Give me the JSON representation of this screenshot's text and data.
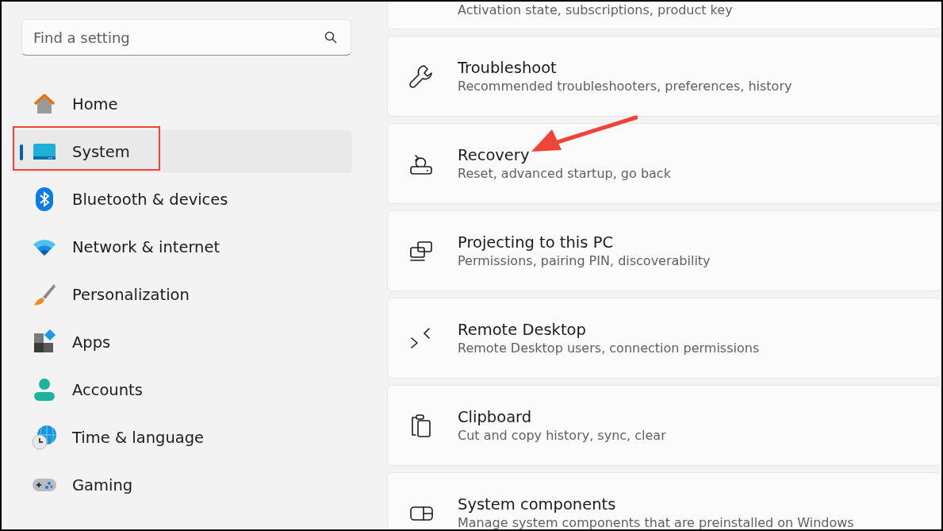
{
  "search": {
    "placeholder": "Find a setting"
  },
  "sidebar": {
    "items": [
      {
        "label": "Home",
        "kind": "home",
        "selected": false,
        "highlighted": false
      },
      {
        "label": "System",
        "kind": "system",
        "selected": true,
        "highlighted": true
      },
      {
        "label": "Bluetooth & devices",
        "kind": "bluetooth",
        "selected": false,
        "highlighted": false
      },
      {
        "label": "Network & internet",
        "kind": "wifi",
        "selected": false,
        "highlighted": false
      },
      {
        "label": "Personalization",
        "kind": "brush",
        "selected": false,
        "highlighted": false
      },
      {
        "label": "Apps",
        "kind": "apps",
        "selected": false,
        "highlighted": false
      },
      {
        "label": "Accounts",
        "kind": "person",
        "selected": false,
        "highlighted": false
      },
      {
        "label": "Time & language",
        "kind": "globe",
        "selected": false,
        "highlighted": false
      },
      {
        "label": "Gaming",
        "kind": "gamepad",
        "selected": false,
        "highlighted": false
      }
    ]
  },
  "settings": [
    {
      "subtitle": "Activation state, subscriptions, product key",
      "kind": "stub",
      "pointed": false
    },
    {
      "title": "Troubleshoot",
      "subtitle": "Recommended troubleshooters, preferences, history",
      "kind": "wrench",
      "pointed": false
    },
    {
      "title": "Recovery",
      "subtitle": "Reset, advanced startup, go back",
      "kind": "recovery",
      "pointed": true
    },
    {
      "title": "Projecting to this PC",
      "subtitle": "Permissions, pairing PIN, discoverability",
      "kind": "projecting",
      "pointed": false
    },
    {
      "title": "Remote Desktop",
      "subtitle": "Remote Desktop users, connection permissions",
      "kind": "remote",
      "pointed": false
    },
    {
      "title": "Clipboard",
      "subtitle": "Cut and copy history, sync, clear",
      "kind": "clipboard",
      "pointed": false
    },
    {
      "title": "System components",
      "subtitle": "Manage system components that are preinstalled on Windows",
      "kind": "components",
      "pointed": false
    }
  ]
}
